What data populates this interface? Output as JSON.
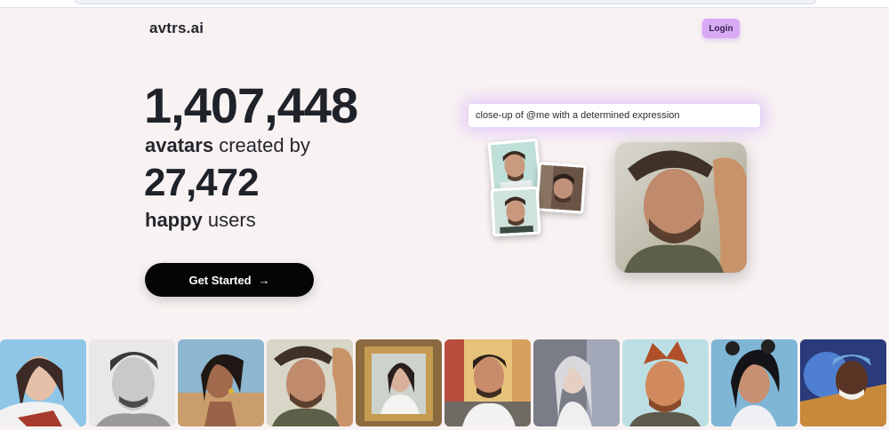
{
  "header": {
    "logo": "avtrs.ai",
    "login_label": "Login"
  },
  "stats": {
    "avatars_count": "1,407,448",
    "avatars_bold": "avatars",
    "avatars_rest": " created by",
    "users_count": "27,472",
    "users_bold": "happy",
    "users_rest": " users"
  },
  "cta": {
    "label": "Get Started",
    "arrow": "→"
  },
  "demo": {
    "prompt_text": "close-up of @me with a determined expression",
    "input_photos": [
      "man-photo-1",
      "man-photo-2",
      "man-photo-3"
    ],
    "result_image": "avatar-man-hat-camel"
  },
  "gallery": [
    "avatar-woman-fur-coat",
    "avatar-man-pencil-sketch",
    "avatar-woman-desert",
    "avatar-man-hat-camel",
    "avatar-woman-framed-portrait",
    "avatar-man-city-street",
    "avatar-woman-silver-hair",
    "avatar-man-comic-style",
    "avatar-girl-anime",
    "avatar-man-colorful-art"
  ]
}
